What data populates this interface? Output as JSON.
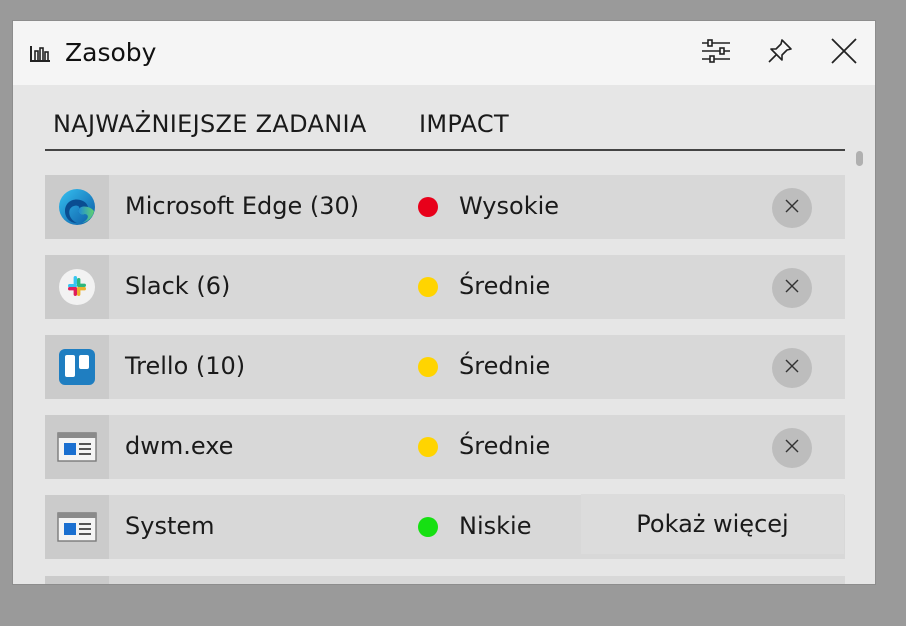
{
  "window": {
    "title": "Zasoby",
    "settings_icon": "sliders-icon",
    "pin_icon": "pin-icon",
    "close_icon": "close-icon"
  },
  "table": {
    "headers": {
      "name": "NAJWAŻNIEJSZE ZADANIA",
      "impact": "IMPACT"
    },
    "rows": [
      {
        "name": "Microsoft Edge (30)",
        "icon": "edge-icon",
        "impact": "Wysokie",
        "impact_color": "#e8001a",
        "action": "end-task"
      },
      {
        "name": "Slack (6)",
        "icon": "slack-icon",
        "impact": "Średnie",
        "impact_color": "#ffd400",
        "action": "end-task"
      },
      {
        "name": "Trello (10)",
        "icon": "trello-icon",
        "impact": "Średnie",
        "impact_color": "#ffd400",
        "action": "end-task"
      },
      {
        "name": "dwm.exe",
        "icon": "window-app-icon",
        "impact": "Średnie",
        "impact_color": "#ffd400",
        "action": "end-task"
      },
      {
        "name": "System",
        "icon": "window-app-icon",
        "impact": "Niskie",
        "impact_color": "#16e012",
        "action": "show-more"
      }
    ]
  },
  "show_more_label": "Pokaż więcej"
}
